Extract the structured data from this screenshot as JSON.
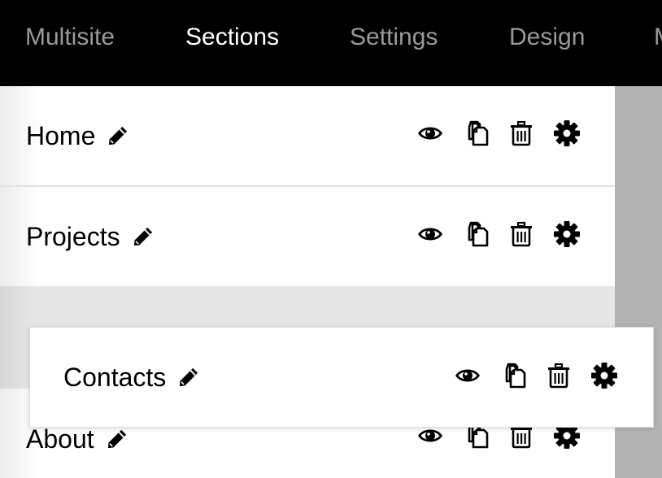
{
  "nav": {
    "items": [
      {
        "label": "Multisite",
        "active": false
      },
      {
        "label": "Sections",
        "active": true
      },
      {
        "label": "Settings",
        "active": false
      },
      {
        "label": "Design",
        "active": false
      },
      {
        "label": "M",
        "active": false
      }
    ]
  },
  "sections": [
    {
      "title": "Home"
    },
    {
      "title": "Projects"
    },
    {
      "title": "About"
    }
  ],
  "dragging": {
    "title": "Contacts"
  },
  "icons": {
    "edit": "pencil-icon",
    "preview": "eye-icon",
    "duplicate": "copy-icon",
    "delete": "trash-icon",
    "settings": "gear-icon"
  }
}
